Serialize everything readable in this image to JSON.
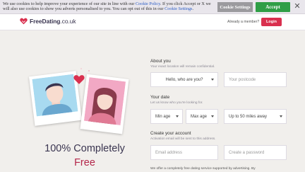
{
  "cookie": {
    "text_part1": "We use cookies to help improve your experience of our site in line with our ",
    "policy_link": "Cookie Policy",
    "text_part2": ". If you click Accept or X we will also use cookies to show you adverts personalised to you. You can opt out of this in our ",
    "settings_link": "Cookie Settings",
    "text_part3": ".",
    "settings_button": "Cookie Settings",
    "accept_button": "Accept",
    "close_glyph": "✕"
  },
  "header": {
    "logo_bold": "FreeDating",
    "logo_suffix": ".co.uk",
    "member_text": "Already a member?",
    "login_button": "Login"
  },
  "hero": {
    "line1": "100% Completely",
    "line2": "Free"
  },
  "form": {
    "about": {
      "title": "About you",
      "subtitle": "Your exact location will remain confidential.",
      "who_select": "Hello, who are you?",
      "postcode_placeholder": "Your postcode"
    },
    "date": {
      "title": "Your date",
      "subtitle": "Let us know who you're looking for.",
      "min_age": "Min age",
      "max_age": "Max age",
      "distance": "Up to 50 miles away"
    },
    "account": {
      "title": "Create your account",
      "subtitle": "Activation email will be sent to this address.",
      "email_placeholder": "Email address",
      "password_placeholder": "Create a password"
    },
    "note": "We offer a completely free dating service supported by advertising. By"
  },
  "colors": {
    "accent": "#d9304f",
    "accept_green": "#2f9e46",
    "settings_gray": "#9b9a9e",
    "brand_dark": "#3a3550"
  }
}
